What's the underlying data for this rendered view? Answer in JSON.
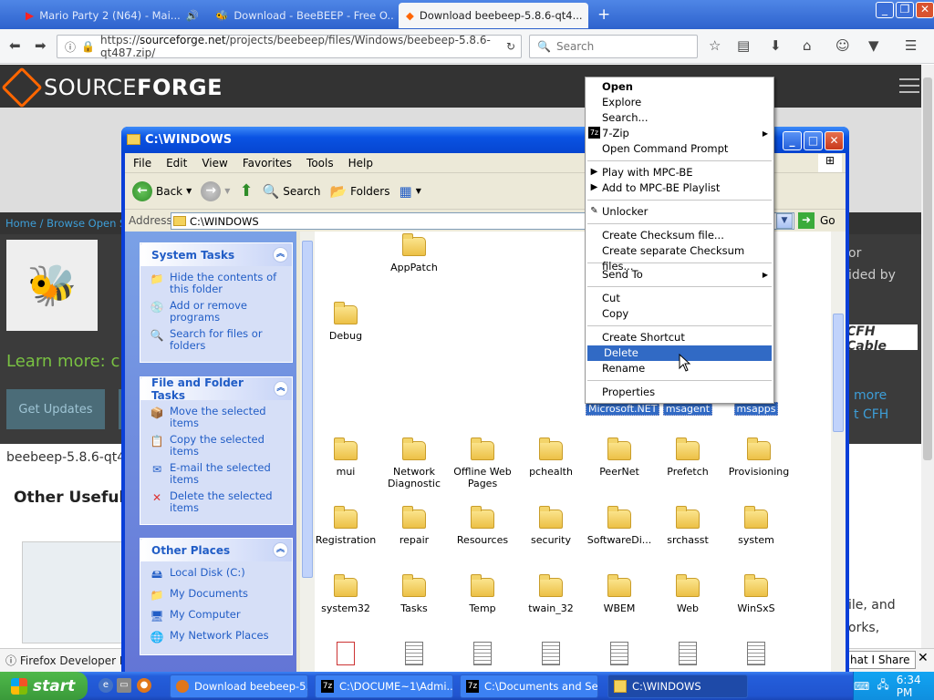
{
  "browser": {
    "tabs": [
      {
        "title": "Mario Party 2 (N64) - Mai...",
        "icon": "youtube-icon"
      },
      {
        "title": "Download - BeeBEEP - Free O...",
        "icon": "beebeep-icon"
      },
      {
        "title": "Download beebeep-5.8.6-qt4...",
        "icon": "sourceforge-icon"
      }
    ],
    "new_tab": "+",
    "url_prefix": "https://",
    "url_host": "sourceforge.net",
    "url_path": "/projects/beebeep/files/Windows/beebeep-5.8.6-qt487.zip/",
    "search_placeholder": "Search"
  },
  "page": {
    "logo_source": "SOURCE",
    "logo_forge": "FORGE",
    "breadcrumb": "Home / Browse Open So",
    "learn_more": "Learn more: ch",
    "get_updates": "Get Updates",
    "file_name": "beebeep-5.8.6-qt4",
    "other_useful": "Other Useful B",
    "right_text_1": "or",
    "right_text_2": "ided by",
    "right_logo": "CFH Cable",
    "right_more_1": "more",
    "right_more_2": "t CFH",
    "right_bottom_1": "ile, and",
    "right_bottom_2": "orks,"
  },
  "notification": {
    "text": "Firefox Developer Edi",
    "share": "hat I Share",
    "close": "✕"
  },
  "explorer": {
    "title": "C:\\WINDOWS",
    "menu": [
      "File",
      "Edit",
      "View",
      "Favorites",
      "Tools",
      "Help"
    ],
    "toolbar": {
      "back": "Back",
      "search": "Search",
      "folders": "Folders"
    },
    "address_label": "Address",
    "address_value": "C:\\WINDOWS",
    "go": "Go",
    "system_tasks": {
      "title": "System Tasks",
      "items": [
        "Hide the contents of this folder",
        "Add or remove programs",
        "Search for files or folders"
      ]
    },
    "file_tasks": {
      "title": "File and Folder Tasks",
      "items": [
        "Move the selected items",
        "Copy the selected items",
        "E-mail the selected items",
        "Delete the selected items"
      ]
    },
    "other_places": {
      "title": "Other Places",
      "items": [
        "Local Disk (C:)",
        "My Documents",
        "My Computer",
        "My Network Places"
      ]
    },
    "files": {
      "row0": [
        "AppPatch"
      ],
      "row1": [
        "Debug"
      ],
      "selected": [
        "Microsoft.NET",
        "msagent",
        "msapps"
      ],
      "row3": [
        "mui",
        "Network Diagnostic",
        "Offline Web Pages",
        "pchealth",
        "PeerNet",
        "Prefetch",
        "Provisioning"
      ],
      "row4": [
        "Registration",
        "repair",
        "Resources",
        "security",
        "SoftwareDi...",
        "srchasst",
        "system"
      ],
      "row5": [
        "system32",
        "Tasks",
        "Temp",
        "twain_32",
        "WBEM",
        "Web",
        "WinSxS"
      ]
    }
  },
  "context_menu": {
    "items": [
      {
        "label": "Open",
        "bold": true
      },
      {
        "label": "Explore"
      },
      {
        "label": "Search..."
      },
      {
        "label": "7-Zip",
        "submenu": true,
        "icon": "7z"
      },
      {
        "label": "Open Command Prompt"
      },
      {
        "sep": true
      },
      {
        "label": "Play with MPC-BE",
        "icon": "▶"
      },
      {
        "label": "Add to MPC-BE Playlist",
        "icon": "▶"
      },
      {
        "sep": true
      },
      {
        "label": "Unlocker",
        "icon": "✎"
      },
      {
        "sep": true
      },
      {
        "label": "Create Checksum file..."
      },
      {
        "label": "Create separate Checksum files..."
      },
      {
        "sep": true
      },
      {
        "label": "Send To",
        "submenu": true
      },
      {
        "sep": true
      },
      {
        "label": "Cut"
      },
      {
        "label": "Copy"
      },
      {
        "sep": true
      },
      {
        "label": "Create Shortcut"
      },
      {
        "label": "Delete",
        "highlight": true
      },
      {
        "label": "Rename"
      },
      {
        "sep": true
      },
      {
        "label": "Properties"
      }
    ]
  },
  "taskbar": {
    "start": "start",
    "tasks": [
      {
        "label": "Download beebeep-5...",
        "icon": "firefox-icon"
      },
      {
        "label": "C:\\DOCUME~1\\Admi...",
        "icon": "7z"
      },
      {
        "label": "C:\\Documents and Se...",
        "icon": "7z"
      },
      {
        "label": "C:\\WINDOWS",
        "icon": "folder-icon"
      }
    ],
    "clock": "6:34 PM"
  }
}
